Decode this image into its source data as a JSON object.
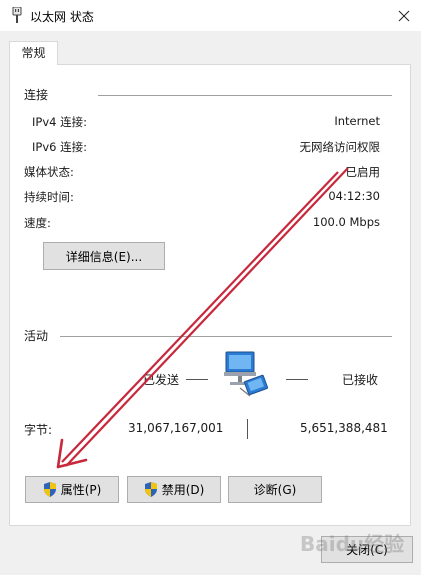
{
  "window": {
    "title": "以太网 状态"
  },
  "tabs": [
    {
      "label": "常规"
    }
  ],
  "connection": {
    "heading": "连接",
    "rows": [
      {
        "label": "IPv4 连接:",
        "value": "Internet"
      },
      {
        "label": "IPv6 连接:",
        "value": "无网络访问权限"
      },
      {
        "label": "媒体状态:",
        "value": "已启用"
      },
      {
        "label": "持续时间:",
        "value": "04:12:30"
      },
      {
        "label": "速度:",
        "value": "100.0 Mbps"
      }
    ],
    "details_button": "详细信息(E)..."
  },
  "activity": {
    "heading": "活动",
    "sent_label": "已发送",
    "received_label": "已接收",
    "bytes_label": "字节:",
    "bytes_sent": "31,067,167,001",
    "bytes_received": "5,651,388,481"
  },
  "buttons": {
    "properties": "属性(P)",
    "disable": "禁用(D)",
    "diagnose": "诊断(G)",
    "close": "关闭(C)"
  },
  "colors": {
    "arrow": "#c8283c",
    "shield_blue": "#2f63b8",
    "shield_yellow": "#f1c40f"
  },
  "watermark": "Baidu经验"
}
